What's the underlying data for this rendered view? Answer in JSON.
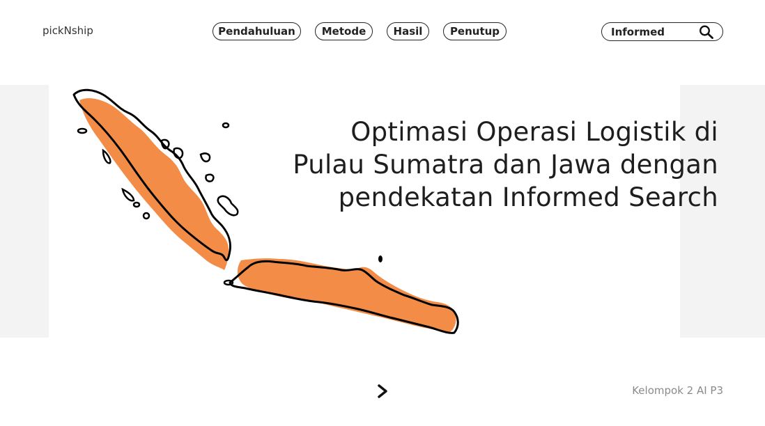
{
  "header": {
    "brand": "pickNship",
    "nav": [
      {
        "label": "Pendahuluan"
      },
      {
        "label": "Metode"
      },
      {
        "label": "Hasil"
      },
      {
        "label": "Penutup"
      }
    ],
    "search": {
      "value": "Informed",
      "icon": "search-icon"
    }
  },
  "hero": {
    "title": "Optimasi Operasi Logistik di Pulau Sumatra dan Jawa dengan pendekatan Informed Search",
    "illustration": "sumatra-java-map",
    "colors": {
      "map_fill": "#f28c46",
      "outline": "#000000",
      "side_panels": "#f3f3f3"
    }
  },
  "footer": {
    "next_icon": "chevron-right-icon",
    "credit": "Kelompok 2 AI P3"
  }
}
